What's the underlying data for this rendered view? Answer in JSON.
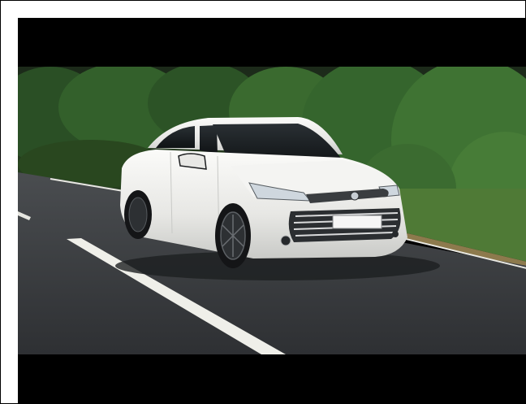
{
  "image": {
    "subject": "white sedan",
    "setting": "road",
    "colors": {
      "letterbox": "#000000",
      "road": "#3b3d40",
      "foliage": "#2f5a2a",
      "car_body": "#eeeeec",
      "lane_marking": "#f2f2ee"
    }
  }
}
